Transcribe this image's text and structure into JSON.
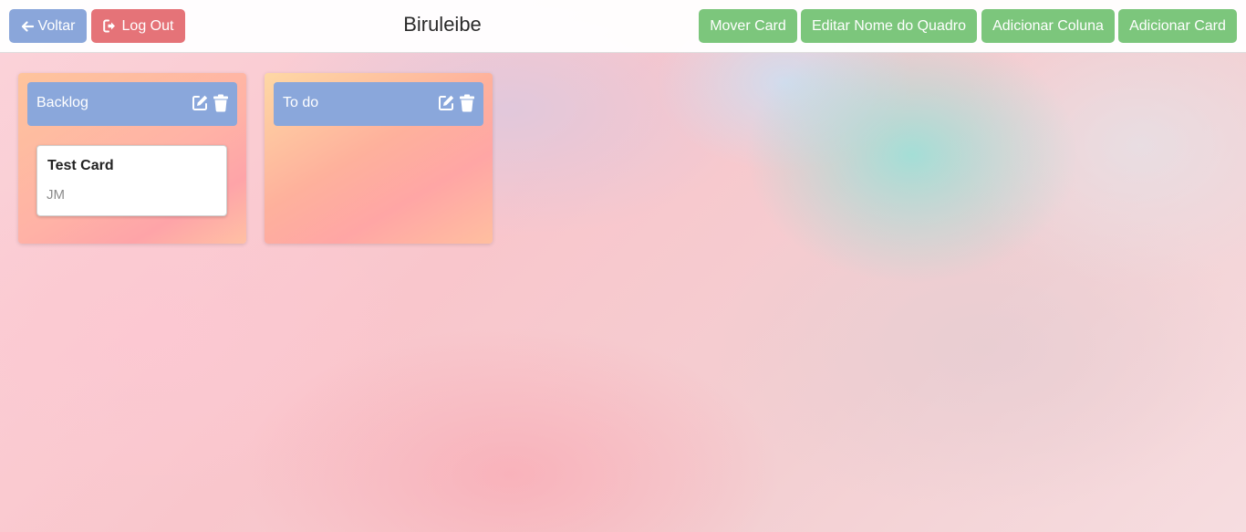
{
  "header": {
    "back_label": "Voltar",
    "logout_label": "Log Out",
    "board_title": "Biruleibe",
    "actions": {
      "move_card": "Mover Card",
      "edit_board_name": "Editar Nome do Quadro",
      "add_column": "Adicionar Coluna",
      "add_card": "Adicionar Card"
    }
  },
  "columns": [
    {
      "title": "Backlog",
      "icons": [
        "edit-icon",
        "trash-icon"
      ],
      "cards": [
        {
          "title": "Test Card",
          "initials": "JM"
        }
      ]
    },
    {
      "title": "To do",
      "icons": [
        "edit-icon",
        "trash-icon"
      ],
      "cards": []
    }
  ],
  "colors": {
    "primary_blue": "#8aa6da",
    "danger_red": "#e57378",
    "success_green": "#7cc67c"
  }
}
